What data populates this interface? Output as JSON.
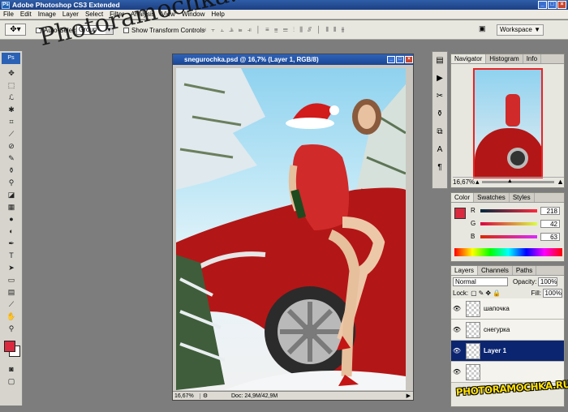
{
  "title": "Adobe Photoshop CS3 Extended",
  "menu": [
    "File",
    "Edit",
    "Image",
    "Layer",
    "Select",
    "Filter",
    "Analysis",
    "View",
    "Window",
    "Help"
  ],
  "options": {
    "auto_select_label": "Auto-Select:",
    "auto_select_value": "Group",
    "transform_label": "Show Transform Controls",
    "workspace_label": "Workspace ▼"
  },
  "watermark_top": "Photoramochka.ru",
  "document": {
    "title": "snegurochka.psd @ 16,7% (Layer 1, RGB/8)",
    "zoom": "16,67%",
    "doc_size": "Doc: 24,9M/42,9M"
  },
  "navigator": {
    "tabs": [
      "Navigator",
      "Histogram",
      "Info"
    ],
    "zoom": "16,67%"
  },
  "color": {
    "tabs": [
      "Color",
      "Swatches",
      "Styles"
    ],
    "r": "218",
    "g": "42",
    "b": "63",
    "r_label": "R",
    "g_label": "G",
    "b_label": "B",
    "fg_color": "#da2a3f"
  },
  "layers": {
    "tabs": [
      "Layers",
      "Channels",
      "Paths"
    ],
    "blend": "Normal",
    "opacity_label": "Opacity:",
    "opacity": "100%",
    "lock_label": "Lock:",
    "fill_label": "Fill:",
    "fill": "100%",
    "items": [
      {
        "name": "шапочка"
      },
      {
        "name": "снегурка"
      },
      {
        "name": "Layer 1"
      }
    ]
  },
  "bottom_logo": "PHOTORAMOCHKA.RU"
}
